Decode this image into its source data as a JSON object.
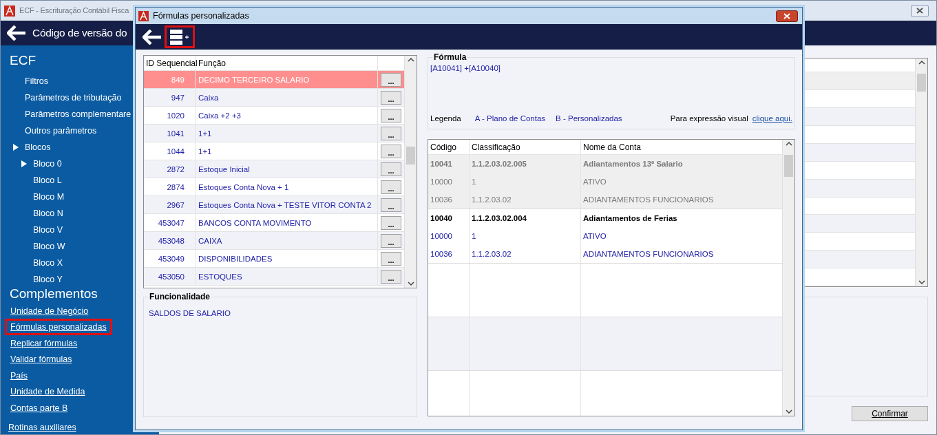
{
  "main_window": {
    "title": "ECF - Escrituração Contábil Fisca",
    "header_title": "Código de versão do",
    "confirm_button": "Confirmar"
  },
  "sidebar": {
    "heading": "ECF",
    "items": [
      {
        "label": "Filtros",
        "arrow": false
      },
      {
        "label": "Parâmetros de tributação",
        "arrow": false
      },
      {
        "label": "Parâmetros complementare",
        "arrow": false
      },
      {
        "label": "Outros parâmetros",
        "arrow": false
      },
      {
        "label": "Blocos",
        "arrow": true,
        "children": [
          {
            "label": "Bloco 0",
            "arrow": true
          },
          {
            "label": "Bloco L",
            "arrow": false
          },
          {
            "label": "Bloco M",
            "arrow": false
          },
          {
            "label": "Bloco N",
            "arrow": false
          },
          {
            "label": "Bloco V",
            "arrow": false
          },
          {
            "label": "Bloco W",
            "arrow": false
          },
          {
            "label": "Bloco X",
            "arrow": false
          },
          {
            "label": "Bloco Y",
            "arrow": false
          }
        ]
      }
    ],
    "section_heading": "Complementos",
    "links": [
      {
        "label": "Unidade de Negócio",
        "highlighted": false
      },
      {
        "label": "Fórmulas personalizadas",
        "highlighted": true
      },
      {
        "label": "Replicar fórmulas",
        "highlighted": false
      },
      {
        "label": "Validar fórmulas",
        "highlighted": false
      },
      {
        "label": "País",
        "highlighted": false
      },
      {
        "label": "Unidade de Medida",
        "highlighted": false
      },
      {
        "label": "Contas parte B",
        "highlighted": false
      }
    ],
    "footer_link": "Rotinas auxiliares"
  },
  "dialog": {
    "title": "Fórmulas personalizadas",
    "toolbar": {
      "add_highlighted": true
    },
    "formulas_table": {
      "columns": [
        "ID Sequencial",
        "Função"
      ],
      "rows": [
        {
          "id": "849",
          "funcao": "DECIMO TERCEIRO SALARIO",
          "action": "...",
          "selected": true
        },
        {
          "id": "947",
          "funcao": "Caixa",
          "action": "...",
          "selected": false
        },
        {
          "id": "1020",
          "funcao": "Caixa +2 +3",
          "action": "...",
          "selected": false
        },
        {
          "id": "1041",
          "funcao": "1+1",
          "action": "...",
          "selected": false
        },
        {
          "id": "1044",
          "funcao": "1+1",
          "action": "...",
          "selected": false
        },
        {
          "id": "2872",
          "funcao": "Estoque Inicial",
          "action": "...",
          "selected": false
        },
        {
          "id": "2874",
          "funcao": "Estoques Conta Nova  + 1",
          "action": "...",
          "selected": false
        },
        {
          "id": "2967",
          "funcao": "Estoques Conta Nova + TESTE VITOR CONTA 2",
          "action": "...",
          "selected": false
        },
        {
          "id": "453047",
          "funcao": "BANCOS CONTA MOVIMENTO",
          "action": "...",
          "selected": false
        },
        {
          "id": "453048",
          "funcao": "CAIXA",
          "action": "...",
          "selected": false
        },
        {
          "id": "453049",
          "funcao": "DISPONIBILIDADES",
          "action": "...",
          "selected": false
        },
        {
          "id": "453050",
          "funcao": "ESTOQUES",
          "action": "...",
          "selected": false
        }
      ]
    },
    "funcionalidade": {
      "legend": "Funcionalidade",
      "text": "SALDOS DE SALARIO"
    },
    "formula": {
      "legend": "Fórmula",
      "expression": "[A10041] +[A10040]",
      "legend_label": "Legenda",
      "legend_a": "A - Plano de Contas",
      "legend_b": "B - Personalizadas",
      "visual_label": "Para expressão visual",
      "visual_link": "clique aqui."
    },
    "accounts_table": {
      "columns": [
        "Código",
        "Classificação",
        "Nome da Conta"
      ],
      "groups": [
        {
          "dimmed": true,
          "rows": [
            {
              "kind": "total",
              "codigo": "10041",
              "classificacao": "1.1.2.03.02.005",
              "nome": "Adiantamentos 13º Salario"
            },
            {
              "kind": "detail",
              "codigo": "10000",
              "classificacao": "1",
              "nome": "ATIVO"
            },
            {
              "kind": "detail",
              "codigo": "10036",
              "classificacao": "1.1.2.03.02",
              "nome": "ADIANTAMENTOS FUNCIONARIOS"
            }
          ]
        },
        {
          "dimmed": false,
          "rows": [
            {
              "kind": "total",
              "codigo": "10040",
              "classificacao": "1.1.2.03.02.004",
              "nome": "Adiantamentos de Ferias"
            },
            {
              "kind": "detail",
              "codigo": "10000",
              "classificacao": "1",
              "nome": "ATIVO"
            },
            {
              "kind": "detail",
              "codigo": "10036",
              "classificacao": "1.1.2.03.02",
              "nome": "ADIANTAMENTOS FUNCIONARIOS"
            }
          ]
        }
      ]
    }
  }
}
